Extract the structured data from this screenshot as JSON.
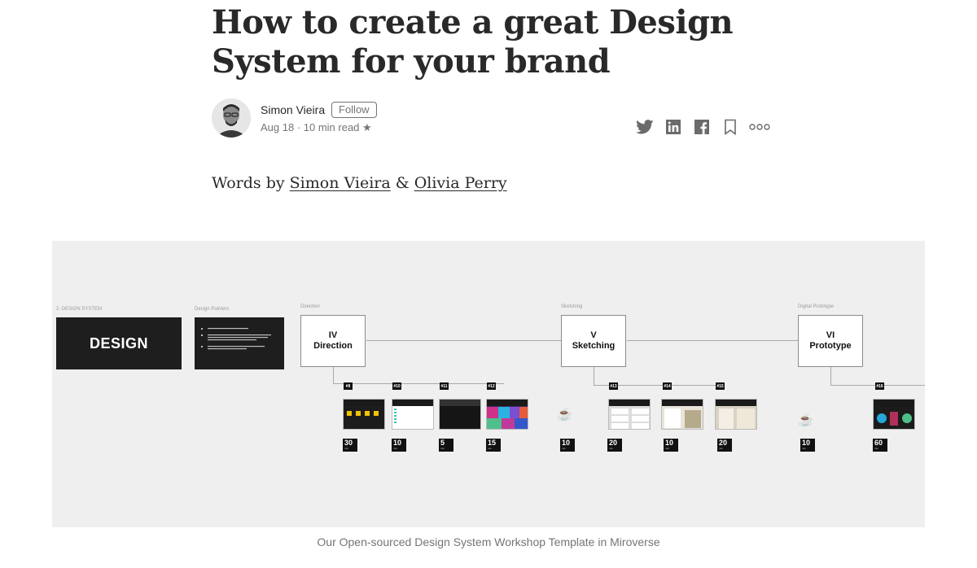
{
  "article": {
    "title": "How to create a great Design System for your brand",
    "byline_prefix": "Words by ",
    "author_link_1": "Simon Vieira",
    "byline_amp": " & ",
    "author_link_2": "Olivia Perry"
  },
  "author": {
    "name": "Simon Vieira",
    "follow_label": "Follow",
    "meta": "Aug 18 · 10 min read ★"
  },
  "actions": [
    "twitter-icon",
    "linkedin-icon",
    "facebook-icon",
    "bookmark-icon",
    "more-icon"
  ],
  "figure": {
    "caption": "Our Open-sourced Design System Workshop Template in Miroverse",
    "board": {
      "section_label": "2. DESIGN SYSTEM",
      "design_card_text": "DESIGN",
      "pointers_label": "Design Pointers",
      "phases": [
        {
          "label": "Direction",
          "numeral": "IV",
          "name": "Direction"
        },
        {
          "label": "Sketching",
          "numeral": "V",
          "name": "Sketching"
        },
        {
          "label": "Digital Prototype",
          "numeral": "VI",
          "name": "Prototype"
        }
      ],
      "steps": [
        {
          "num": "#9",
          "minutes": "30"
        },
        {
          "num": "#10",
          "minutes": "10"
        },
        {
          "num": "#11",
          "minutes": "5"
        },
        {
          "num": "#12",
          "minutes": "15"
        },
        {
          "num": "#13",
          "minutes": "20"
        },
        {
          "num": "#14",
          "minutes": "10"
        },
        {
          "num": "#15",
          "minutes": "20"
        },
        {
          "num": "#16",
          "minutes": "60"
        }
      ],
      "breaks": [
        {
          "minutes": "10"
        },
        {
          "minutes": "10"
        }
      ],
      "minute_unit": "min"
    }
  },
  "colors": {
    "text": "#292929",
    "muted": "#757575",
    "board_bg": "#efefef"
  }
}
